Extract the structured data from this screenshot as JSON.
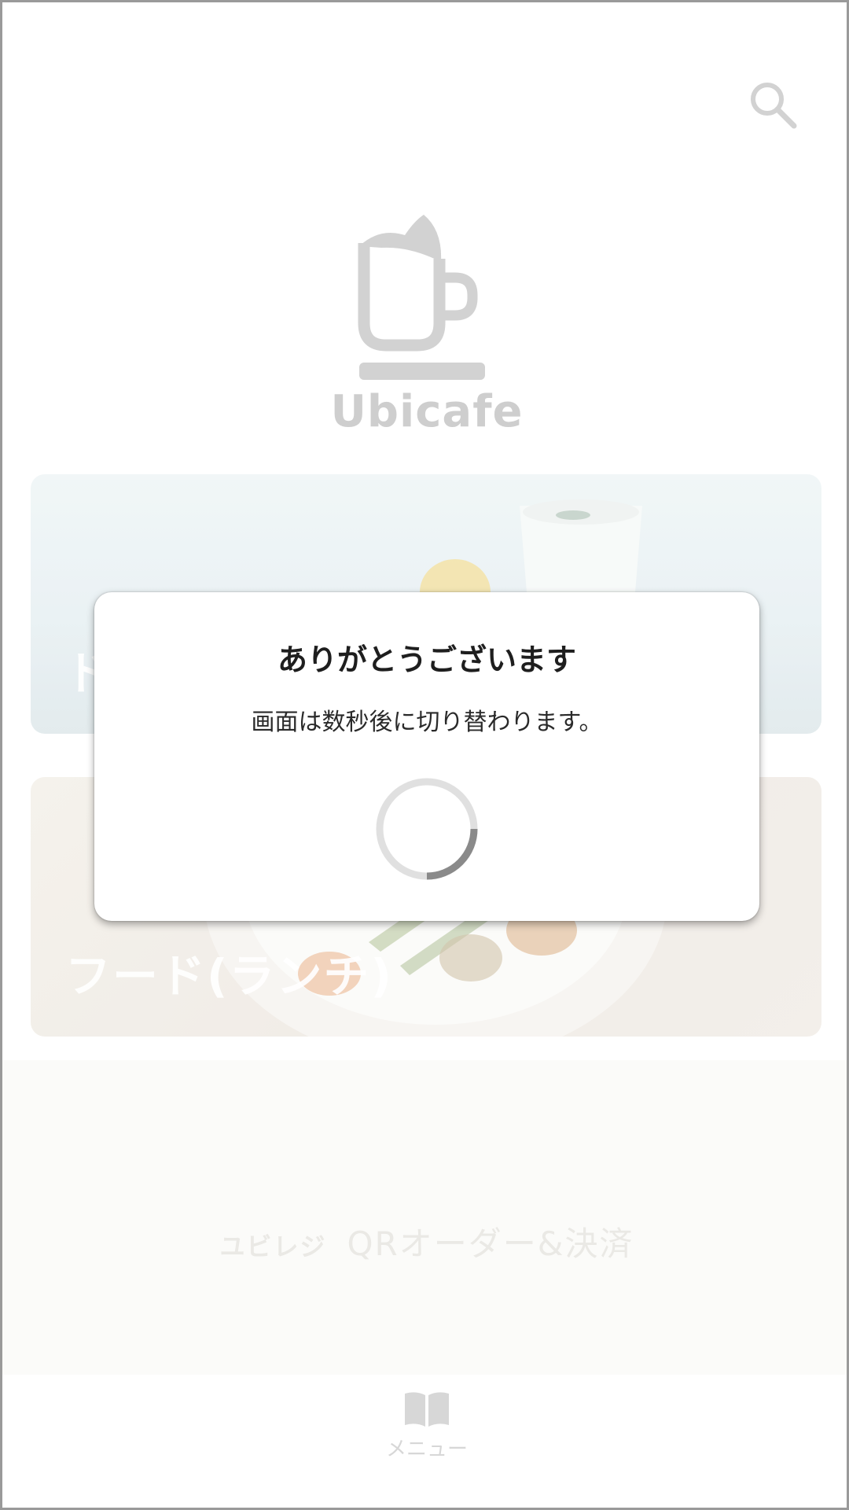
{
  "app": {
    "brand_name": "Ubicafe"
  },
  "header": {
    "search_icon": "search-icon"
  },
  "categories": [
    {
      "label": "ドリンク",
      "visible_label": "ド"
    },
    {
      "label": "フード(ランチ)"
    }
  ],
  "promo": {
    "brand": "ユビレジ",
    "text": "QRオーダー&決済"
  },
  "bottom_nav": {
    "items": [
      {
        "label": "メニュー",
        "icon": "book-icon"
      }
    ]
  },
  "dialog": {
    "title": "ありがとうございます",
    "message": "画面は数秒後に切り替わります。",
    "spinner_icon": "loading-spinner"
  },
  "colors": {
    "logo_gray": "#c4c4c4",
    "spinner_track": "#e0e0e0",
    "spinner_arc": "#8a8a8a",
    "border": "#9a9a9a"
  }
}
